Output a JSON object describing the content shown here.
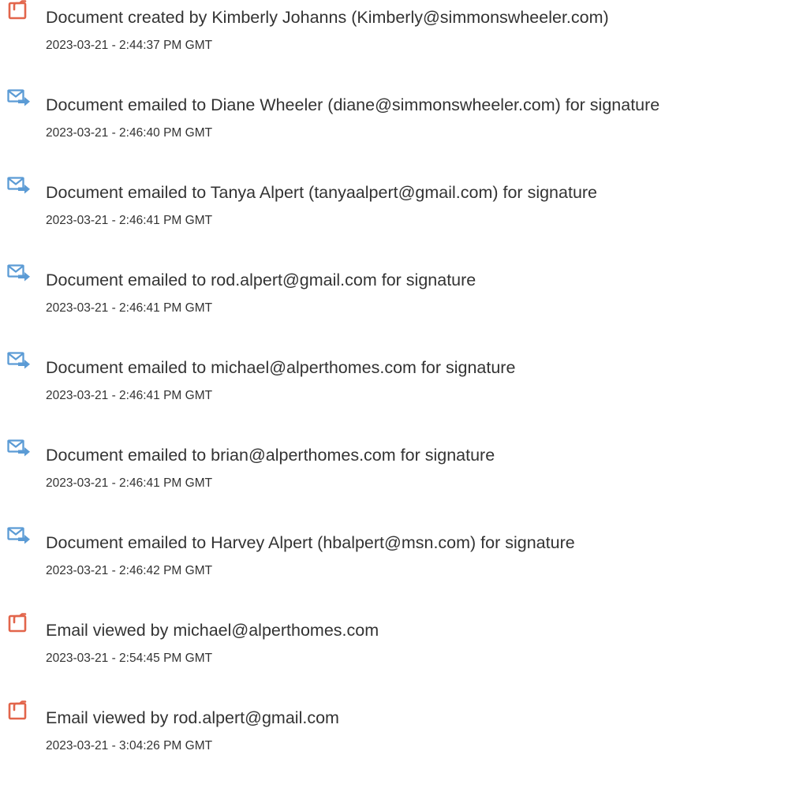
{
  "colors": {
    "created_icon": "#e2654b",
    "email_icon": "#5b9bd5",
    "text": "#333333"
  },
  "events": [
    {
      "icon": "document-created-icon",
      "message": "Document created by Kimberly Johanns (Kimberly@simmonswheeler.com)",
      "timestamp": "2023-03-21 - 2:44:37 PM GMT"
    },
    {
      "icon": "email-sent-icon",
      "message": "Document emailed to Diane Wheeler (diane@simmonswheeler.com) for signature",
      "timestamp": "2023-03-21 - 2:46:40 PM GMT"
    },
    {
      "icon": "email-sent-icon",
      "message": "Document emailed to Tanya Alpert (tanyaalpert@gmail.com) for signature",
      "timestamp": "2023-03-21 - 2:46:41 PM GMT"
    },
    {
      "icon": "email-sent-icon",
      "message": "Document emailed to rod.alpert@gmail.com for signature",
      "timestamp": "2023-03-21 - 2:46:41 PM GMT"
    },
    {
      "icon": "email-sent-icon",
      "message": "Document emailed to michael@alperthomes.com for signature",
      "timestamp": "2023-03-21 - 2:46:41 PM GMT"
    },
    {
      "icon": "email-sent-icon",
      "message": "Document emailed to brian@alperthomes.com for signature",
      "timestamp": "2023-03-21 - 2:46:41 PM GMT"
    },
    {
      "icon": "email-sent-icon",
      "message": "Document emailed to Harvey Alpert (hbalpert@msn.com) for signature",
      "timestamp": "2023-03-21 - 2:46:42 PM GMT"
    },
    {
      "icon": "email-viewed-icon",
      "message": "Email viewed by michael@alperthomes.com",
      "timestamp": "2023-03-21 - 2:54:45 PM GMT"
    },
    {
      "icon": "email-viewed-icon",
      "message": "Email viewed by rod.alpert@gmail.com",
      "timestamp": "2023-03-21 - 3:04:26 PM GMT"
    }
  ]
}
